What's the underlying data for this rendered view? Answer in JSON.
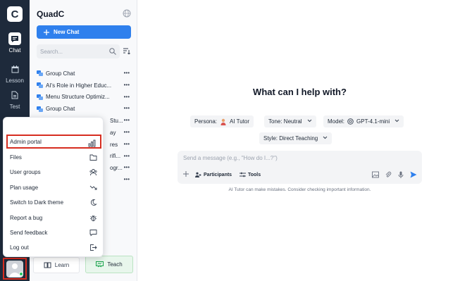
{
  "rail": {
    "logo": "C",
    "items": [
      {
        "label": "Chat",
        "icon": "chat-bubble-icon",
        "active": true
      },
      {
        "label": "Lesson",
        "icon": "calendar-icon",
        "active": false
      },
      {
        "label": "Test",
        "icon": "document-icon",
        "active": false
      }
    ]
  },
  "sidebar": {
    "brand": "QuadC",
    "new_chat_label": "New Chat",
    "search_placeholder": "Search...",
    "chats": [
      {
        "title": "Group Chat"
      },
      {
        "title": "AI's Role in Higher Educ..."
      },
      {
        "title": "Menu Structure Optimiz..."
      },
      {
        "title": "Group Chat"
      },
      {
        "title": "Stu..."
      },
      {
        "title": "ay"
      },
      {
        "title": "res"
      },
      {
        "title": "rifi..."
      },
      {
        "title": "ogr..."
      },
      {
        "title": ""
      }
    ],
    "learn_label": "Learn",
    "teach_label": "Teach"
  },
  "menu": {
    "items": [
      {
        "label": "Admin portal",
        "icon": "bar-chart-icon",
        "highlight": true
      },
      {
        "label": "Files",
        "icon": "folder-icon"
      },
      {
        "label": "User groups",
        "icon": "users-icon"
      },
      {
        "label": "Plan usage",
        "icon": "trend-icon"
      },
      {
        "label": "Switch to Dark theme",
        "icon": "moon-icon"
      },
      {
        "label": "Report a bug",
        "icon": "bug-icon"
      },
      {
        "label": "Send feedback",
        "icon": "message-icon"
      },
      {
        "label": "Log out",
        "icon": "logout-icon"
      }
    ]
  },
  "main": {
    "heading": "What can I help with?",
    "persona_label": "Persona:",
    "persona_value": "AI Tutor",
    "tone_label": "Tone: Neutral",
    "model_label": "Model:",
    "model_value": "GPT-4.1-mini",
    "style_label": "Style: Direct Teaching",
    "input_placeholder": "Send a message (e.g., \"How do I...?\")",
    "participants_label": "Participants",
    "tools_label": "Tools",
    "disclaimer": "AI Tutor can make mistakes. Consider checking important information."
  },
  "colors": {
    "rail_bg": "#1e2a3b",
    "accent_blue": "#2f80ed",
    "highlight_red": "#d62d20",
    "teach_green": "#e8f6ec"
  }
}
